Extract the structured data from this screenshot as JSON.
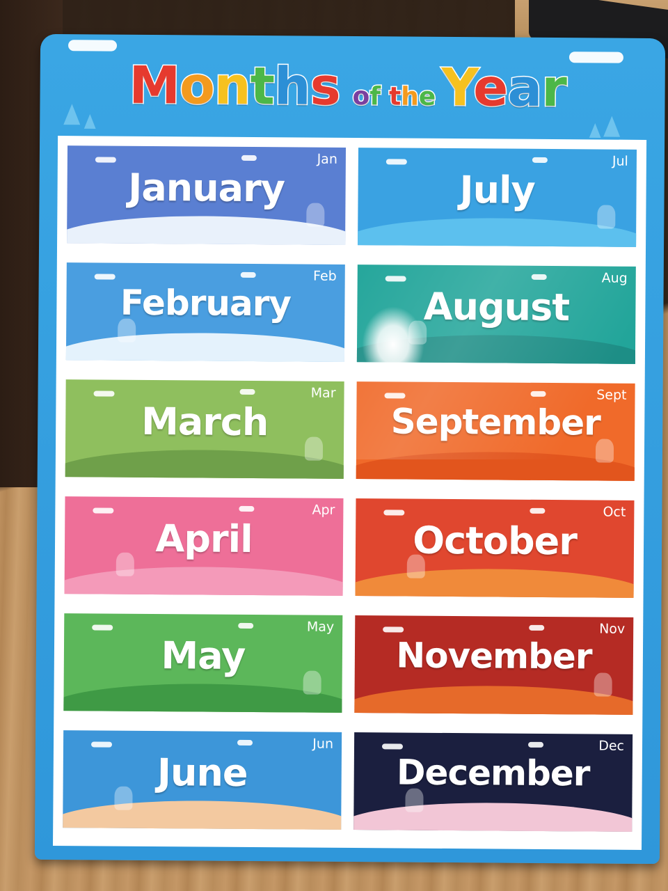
{
  "title": {
    "words": [
      {
        "text": "Months",
        "size": "big",
        "letters": [
          {
            "ch": "M",
            "color": "#e63a2e"
          },
          {
            "ch": "o",
            "color": "#f39a1e"
          },
          {
            "ch": "n",
            "color": "#f6c11f"
          },
          {
            "ch": "t",
            "color": "#4cb748"
          },
          {
            "ch": "h",
            "color": "#2c8fd6"
          },
          {
            "ch": "s",
            "color": "#e63a2e"
          }
        ]
      },
      {
        "text": "of",
        "size": "small",
        "letters": [
          {
            "ch": "o",
            "color": "#7a3fa0"
          },
          {
            "ch": "f",
            "color": "#4cb748"
          }
        ]
      },
      {
        "text": "the",
        "size": "small",
        "letters": [
          {
            "ch": "t",
            "color": "#e63a2e"
          },
          {
            "ch": "h",
            "color": "#f39a1e"
          },
          {
            "ch": "e",
            "color": "#4cb748"
          }
        ]
      },
      {
        "text": "Year",
        "size": "big",
        "letters": [
          {
            "ch": "Y",
            "color": "#f6c11f"
          },
          {
            "ch": "e",
            "color": "#e63a2e"
          },
          {
            "ch": "a",
            "color": "#2c8fd6"
          },
          {
            "ch": "r",
            "color": "#4cb748"
          }
        ]
      }
    ]
  },
  "months": [
    {
      "name": "January",
      "abbr": "Jan",
      "colors": {
        "sky": "#5a7fd2",
        "ground": "#e9f1fb",
        "ground2": "#c9dbf3"
      },
      "icon": "house-icon"
    },
    {
      "name": "February",
      "abbr": "Feb",
      "colors": {
        "sky": "#4a9ee0",
        "ground": "#e4f2fc",
        "ground2": "#bfe0f7"
      },
      "icon": "snowman-icon"
    },
    {
      "name": "March",
      "abbr": "Mar",
      "colors": {
        "sky": "#8fbf5e",
        "ground": "#6fa04a",
        "ground2": "#a9cf7a"
      },
      "icon": "windmill-icon"
    },
    {
      "name": "April",
      "abbr": "Apr",
      "colors": {
        "sky": "#ee6f98",
        "ground": "#f49ab9",
        "ground2": "#f7b5cb"
      },
      "icon": "blossom-tree-icon"
    },
    {
      "name": "May",
      "abbr": "May",
      "colors": {
        "sky": "#5cb75a",
        "ground": "#3f9a45",
        "ground2": "#8fcb6a"
      },
      "icon": "picnic-icon"
    },
    {
      "name": "June",
      "abbr": "Jun",
      "colors": {
        "sky": "#3d96d9",
        "ground": "#f3c9a0",
        "ground2": "#f6d8b6"
      },
      "icon": "beach-umbrella-icon"
    },
    {
      "name": "July",
      "abbr": "Jul",
      "colors": {
        "sky": "#3aa2e2",
        "ground": "#5cc0ee",
        "ground2": "#8dd3f3"
      },
      "icon": "umbrella-icon"
    },
    {
      "name": "August",
      "abbr": "Aug",
      "colors": {
        "sky": "#22a59a",
        "ground": "#1d8e86",
        "ground2": "#2db6a9"
      },
      "icon": "palm-tree-icon"
    },
    {
      "name": "September",
      "abbr": "Sept",
      "colors": {
        "sky": "#f06a2a",
        "ground": "#e2551d",
        "ground2": "#f38a4b"
      },
      "icon": "autumn-tree-icon"
    },
    {
      "name": "October",
      "abbr": "Oct",
      "colors": {
        "sky": "#e0472f",
        "ground": "#f08a3a",
        "ground2": "#f4a354"
      },
      "icon": "pumpkin-icon"
    },
    {
      "name": "November",
      "abbr": "Nov",
      "colors": {
        "sky": "#b52b24",
        "ground": "#e66a2a",
        "ground2": "#f08d46"
      },
      "icon": "maple-leaf-icon"
    },
    {
      "name": "December",
      "abbr": "Dec",
      "colors": {
        "sky": "#1b1f3f",
        "ground": "#f2c6d6",
        "ground2": "#f7dae5"
      },
      "icon": "christmas-tree-icon"
    }
  ]
}
